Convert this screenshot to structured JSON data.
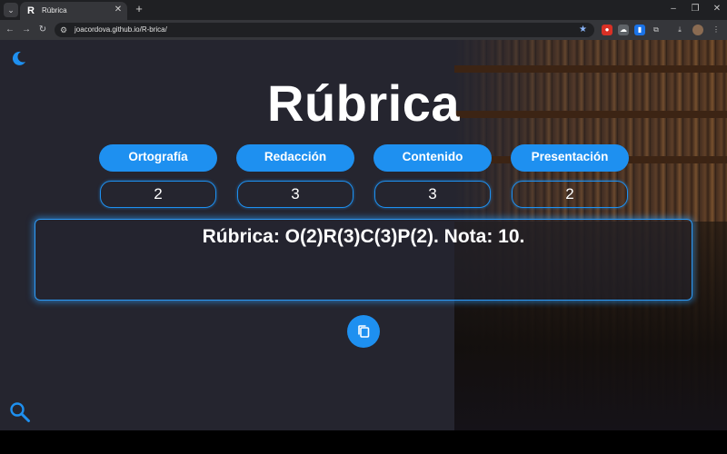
{
  "browser": {
    "tab_title": "Rúbrica",
    "tab_favicon": "R",
    "url": "joacordova.github.io/R-brica/"
  },
  "page": {
    "title": "Rúbrica",
    "categories": [
      {
        "label": "Ortografía",
        "value": "2"
      },
      {
        "label": "Redacción",
        "value": "3"
      },
      {
        "label": "Contenido",
        "value": "3"
      },
      {
        "label": "Presentación",
        "value": "2"
      }
    ],
    "result": "Rúbrica: O(2)R(3)C(3)P(2). Nota: 10."
  },
  "icons": {
    "theme_toggle": "moon-icon",
    "copy": "copy-icon",
    "search": "magnifier-icon"
  },
  "colors": {
    "accent": "#1e90f0",
    "background": "#25252f",
    "text": "#ffffff"
  }
}
